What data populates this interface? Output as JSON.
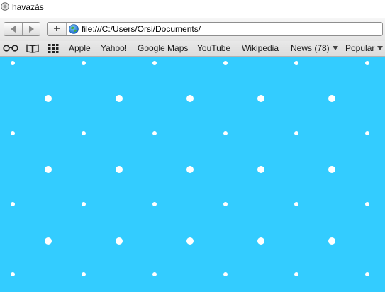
{
  "window": {
    "title": "havazás"
  },
  "toolbar": {
    "back_icon": "back-arrow-icon",
    "forward_icon": "forward-arrow-icon",
    "add_bookmark_label": "+",
    "address": {
      "icon": "globe-icon",
      "value": "file:///C:/Users/Orsi/Documents/"
    }
  },
  "bookmarks": {
    "icons": [
      "reading-list-icon",
      "book-icon",
      "top-sites-grid-icon"
    ],
    "items": [
      {
        "label": "Apple"
      },
      {
        "label": "Yahoo!"
      },
      {
        "label": "Google Maps"
      },
      {
        "label": "YouTube"
      },
      {
        "label": "Wikipedia"
      },
      {
        "label": "News (78)",
        "menu": true
      },
      {
        "label": "Popular",
        "menu": true
      }
    ]
  },
  "page": {
    "background_color": "#33ccff",
    "flake_color": "#ffffff"
  }
}
